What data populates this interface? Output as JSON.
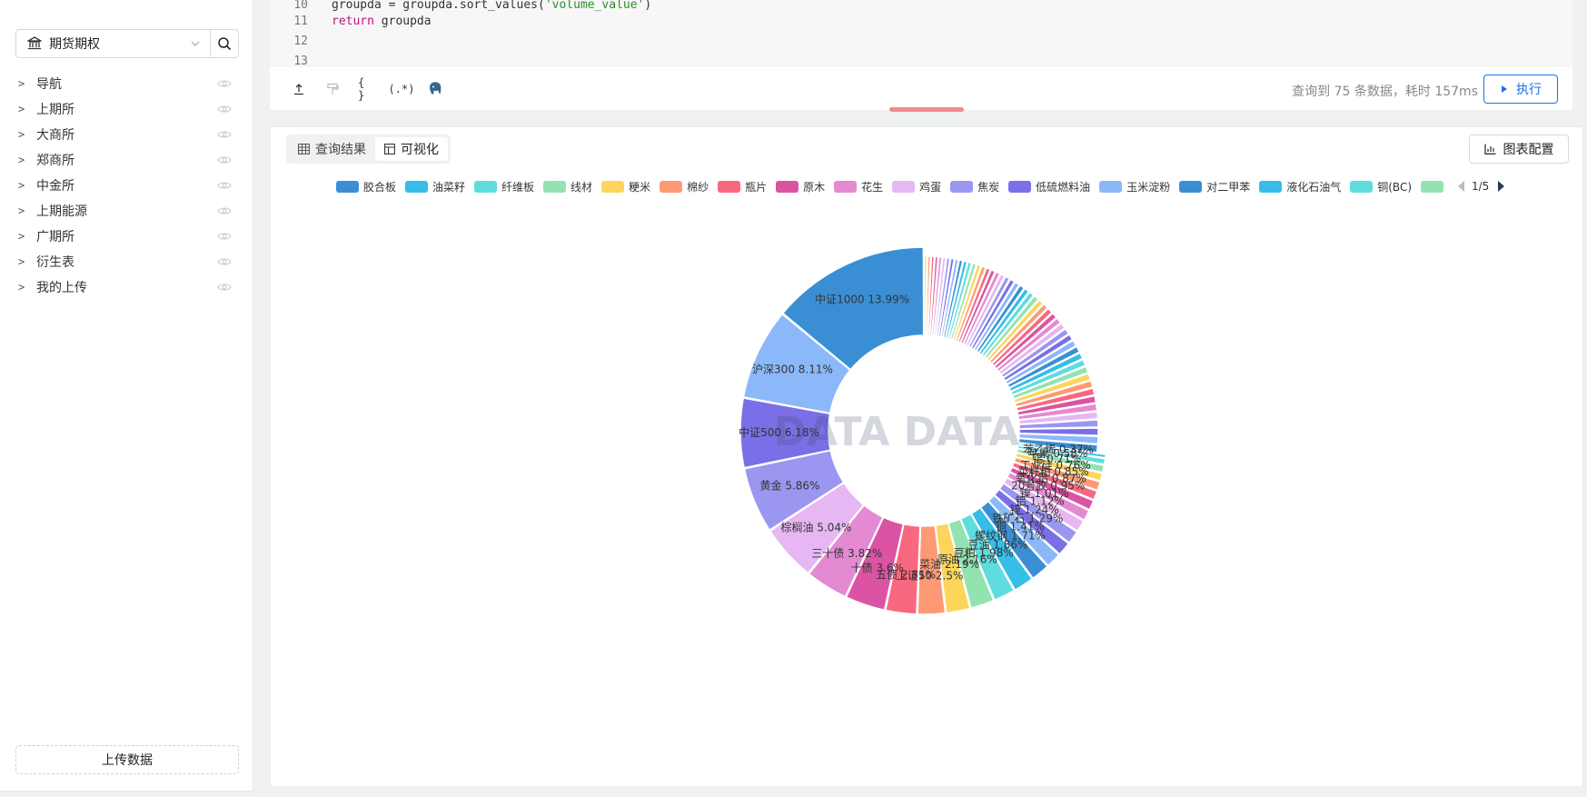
{
  "sidebar": {
    "source_label": "期货期权",
    "tree": [
      {
        "label": "导航"
      },
      {
        "label": "上期所"
      },
      {
        "label": "大商所"
      },
      {
        "label": "郑商所"
      },
      {
        "label": "中金所"
      },
      {
        "label": "上期能源"
      },
      {
        "label": "广期所"
      },
      {
        "label": "衍生表"
      },
      {
        "label": "我的上传"
      }
    ],
    "upload_label": "上传数据"
  },
  "code": {
    "lines": [
      {
        "num": "10",
        "code": "groupda = groupda.sort_values(",
        "str": "'volume_value'",
        "tail": ")"
      },
      {
        "num": "11",
        "kw": "return",
        "code": " groupda"
      },
      {
        "num": "12",
        "code": ""
      },
      {
        "num": "13",
        "code": ""
      }
    ]
  },
  "toolbar": {
    "status": "查询到 75 条数据，耗时 157ms",
    "run_label": "执行"
  },
  "panel": {
    "tab_table": "查询结果",
    "tab_viz": "可视化",
    "config_label": "图表配置",
    "pager": "1/5",
    "watermark": "DATA DATA"
  },
  "legend": [
    {
      "name": "胶合板",
      "color": "#3a8fd4"
    },
    {
      "name": "油菜籽",
      "color": "#36bde8"
    },
    {
      "name": "纤维板",
      "color": "#5fdcde"
    },
    {
      "name": "线材",
      "color": "#93e3b0"
    },
    {
      "name": "粳米",
      "color": "#fdd55a"
    },
    {
      "name": "棉纱",
      "color": "#fd9a75"
    },
    {
      "name": "瓶片",
      "color": "#f8687f"
    },
    {
      "name": "原木",
      "color": "#db54a3"
    },
    {
      "name": "花生",
      "color": "#e38ad2"
    },
    {
      "name": "鸡蛋",
      "color": "#e6b7f2"
    },
    {
      "name": "焦炭",
      "color": "#9b96f0"
    },
    {
      "name": "低硫燃料油",
      "color": "#7a6fe6"
    },
    {
      "name": "玉米淀粉",
      "color": "#8bb8f8"
    },
    {
      "name": "对二甲苯",
      "color": "#3a8fd4"
    },
    {
      "name": "液化石油气",
      "color": "#36bde8"
    },
    {
      "name": "铜(BC)",
      "color": "#5fdcde"
    },
    {
      "name": "",
      "color": "#93e3b0"
    }
  ],
  "palette": [
    "#3a8fd4",
    "#36bde8",
    "#5fdcde",
    "#93e3b0",
    "#fdd55a",
    "#fd9a75",
    "#f8687f",
    "#db54a3",
    "#e38ad2",
    "#e6b7f2",
    "#9b96f0",
    "#7a6fe6",
    "#8bb8f8"
  ],
  "chart_data": {
    "type": "pie",
    "inner_radius_ratio": 0.52,
    "total_series": 75,
    "labeled_slices": [
      {
        "name": "中证1000",
        "value": 13.99,
        "label": "中证1000 13.99%"
      },
      {
        "name": "沪深300",
        "value": 8.11,
        "label": "沪深300 8.11%"
      },
      {
        "name": "中证500",
        "value": 6.18,
        "label": "中证500 6.18%"
      },
      {
        "name": "黄金",
        "value": 5.86,
        "label": "黄金 5.86%"
      },
      {
        "name": "棕榈油",
        "value": 5.04,
        "label": "棕榈油 5.04%"
      },
      {
        "name": "三十债",
        "value": 3.82,
        "label": "三十债 3.82%"
      },
      {
        "name": "十债",
        "value": 3.6,
        "label": "十债 3.6%"
      },
      {
        "name": "五债",
        "value": 2.81,
        "label": "五债 2.81%"
      },
      {
        "name": "上证50",
        "value": 2.5,
        "label": "上证50 2.5%"
      },
      {
        "name": "菜油",
        "value": 2.19,
        "label": "菜油 2.19%"
      },
      {
        "name": "原油",
        "value": 2.16,
        "label": "原油 2.16%"
      },
      {
        "name": "豆粕",
        "value": 1.98,
        "label": "豆粕 1.98%"
      },
      {
        "name": "豆油",
        "value": 1.86,
        "label": "豆油 1.86%"
      },
      {
        "name": "螺纹钢",
        "value": 1.71,
        "label": "螺纹钢 1.71%"
      },
      {
        "name": "铜",
        "value": 1.41,
        "label": "铜 1.41%"
      },
      {
        "name": "铁矿石",
        "value": 1.29,
        "label": "铁矿石 1.29%"
      },
      {
        "name": "锌",
        "value": 1.24,
        "label": "锌 1.24%"
      },
      {
        "name": "铝",
        "value": 1.12,
        "label": "铝 1.12%"
      },
      {
        "name": "镍",
        "value": 1.01,
        "label": "镍 1.01%"
      },
      {
        "name": "20号胶",
        "value": 0.95,
        "label": "20号胶 0.95%"
      },
      {
        "name": "氧化铝",
        "value": 0.87,
        "label": "氧化铝 0.87%"
      },
      {
        "name": "菜籽粕",
        "value": 0.85,
        "label": "菜籽粕 0.85%"
      },
      {
        "name": "工业硅",
        "value": 0.76,
        "label": "工业硅 0.76%"
      },
      {
        "name": "锡",
        "value": 0.71,
        "label": "锡 0.71%"
      },
      {
        "name": "苹果",
        "value": 0.58,
        "label": "苹果 0.58%"
      },
      {
        "name": "苯乙烯",
        "value": 0.37,
        "label": "苯乙烯 0.37%"
      }
    ]
  }
}
